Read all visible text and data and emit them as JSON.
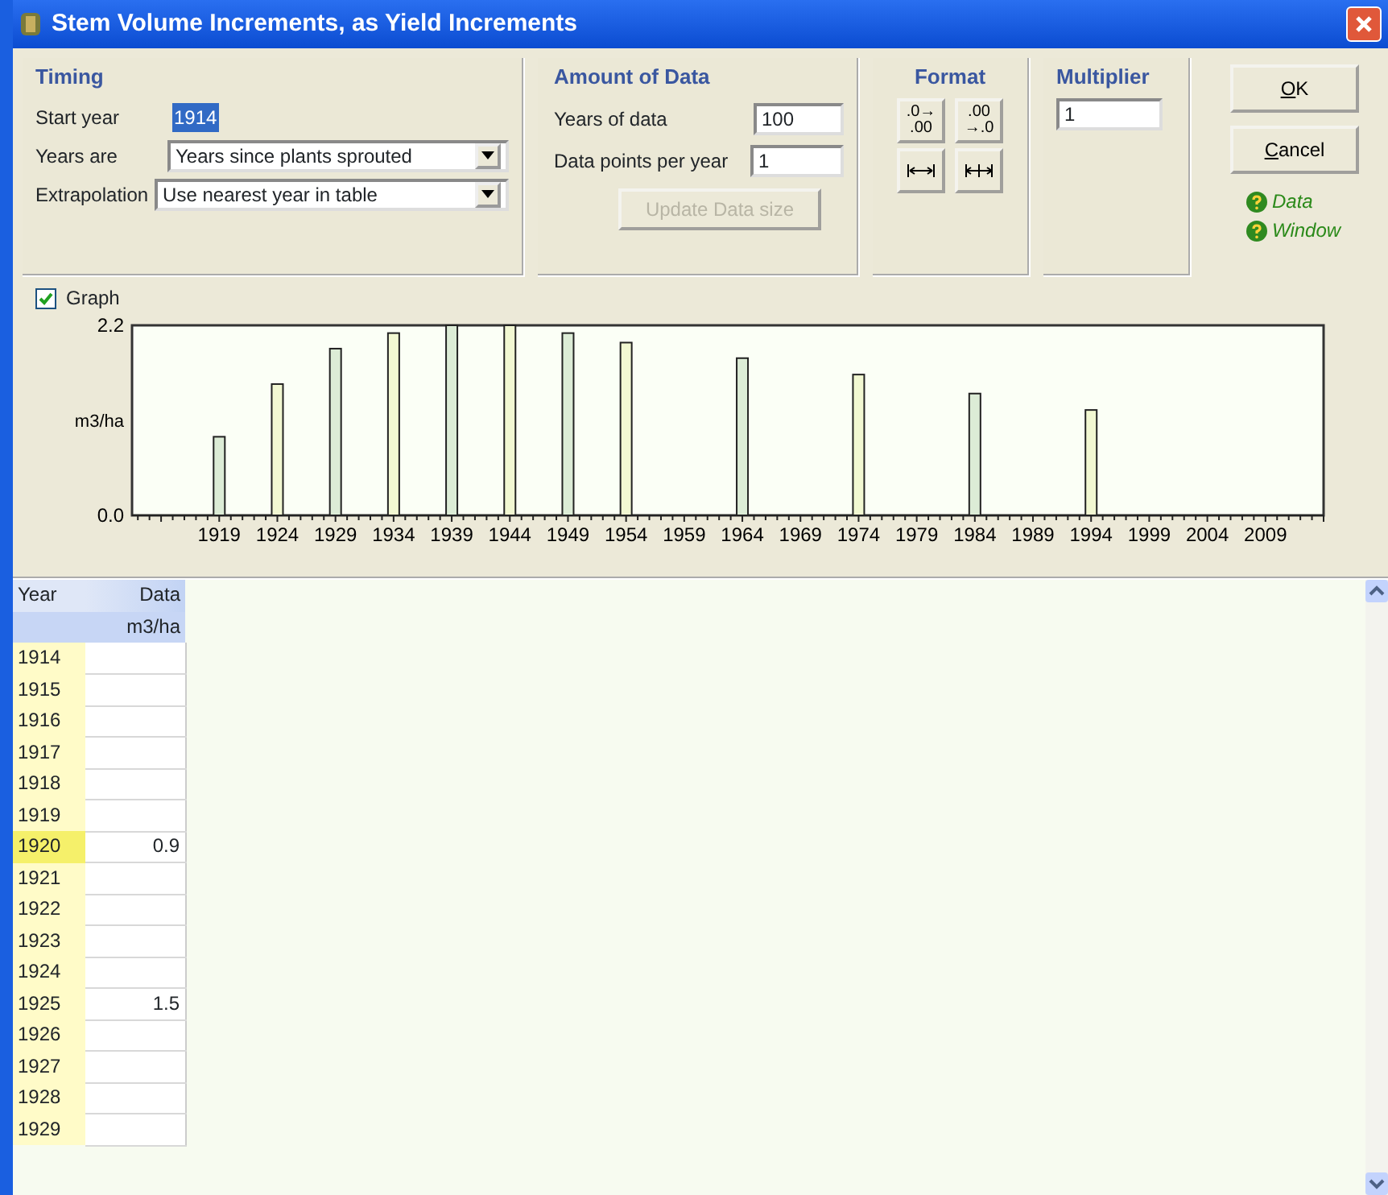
{
  "window": {
    "title": "Stem Volume Increments, as Yield Increments"
  },
  "timing": {
    "title": "Timing",
    "fields": [
      {
        "kind": "text",
        "label": "Start year",
        "value": "1914",
        "selected": true
      },
      {
        "kind": "select",
        "label": "Years are",
        "value": "Years since plants sprouted"
      },
      {
        "kind": "select",
        "label": "Extrapolation",
        "value": "Use nearest year in table"
      }
    ]
  },
  "amount": {
    "title": "Amount of Data",
    "fields": [
      {
        "label": "Years of data",
        "value": "100"
      },
      {
        "label": "Data points per year",
        "value": "1"
      }
    ],
    "update_button": {
      "label": "Update Data size",
      "disabled": true
    }
  },
  "format": {
    "title": "Format",
    "buttons": [
      {
        "kind": "text",
        "lines": [
          ".0→",
          ".00"
        ]
      },
      {
        "kind": "text",
        "lines": [
          ".00",
          "→.0"
        ]
      },
      {
        "kind": "widen"
      },
      {
        "kind": "narrow"
      }
    ]
  },
  "multiplier": {
    "title": "Multiplier",
    "value": "1"
  },
  "buttons": [
    {
      "label": "OK"
    },
    {
      "label": "Cancel"
    }
  ],
  "help_links": [
    "Data",
    "Window"
  ],
  "graph": {
    "label": "Graph",
    "checked": true,
    "chart_data": {
      "type": "bar",
      "ylabel": "m3/ha",
      "x": [
        1919,
        1924,
        1929,
        1934,
        1939,
        1944,
        1949,
        1954,
        1964,
        1974,
        1984,
        1994
      ],
      "series": [
        {
          "values": [
            0.91,
            1.52,
            1.93,
            2.11,
            2.2,
            2.2,
            2.11,
            2.0,
            1.82,
            1.63,
            1.41,
            1.22
          ]
        }
      ],
      "xlim": [
        1911.5,
        2014
      ],
      "ylim": [
        0,
        2.2
      ],
      "xticks": [
        1919,
        1924,
        1929,
        1934,
        1939,
        1944,
        1949,
        1954,
        1959,
        1964,
        1969,
        1974,
        1979,
        1984,
        1989,
        1994,
        1999,
        2004,
        2009
      ],
      "yticks": [
        {
          "value": 0,
          "label": "0.0"
        },
        {
          "value": 2.2,
          "label": "2.2"
        }
      ]
    }
  },
  "table": {
    "columns": [
      {
        "label": "Year"
      },
      {
        "label": "Data",
        "unit": "m3/ha"
      }
    ],
    "rows": [
      {
        "year": "1914",
        "selected": false
      },
      {
        "year": "1915",
        "selected": false
      },
      {
        "year": "1916",
        "selected": false
      },
      {
        "year": "1917",
        "selected": false
      },
      {
        "year": "1918",
        "selected": false
      },
      {
        "year": "1919",
        "selected": false
      },
      {
        "year": "1920",
        "data": "0.9",
        "selected": true
      },
      {
        "year": "1921",
        "selected": false
      },
      {
        "year": "1922",
        "selected": false
      },
      {
        "year": "1923",
        "selected": false
      },
      {
        "year": "1924",
        "selected": false
      },
      {
        "year": "1925",
        "data": "1.5",
        "selected": false
      },
      {
        "year": "1926",
        "selected": false
      },
      {
        "year": "1927",
        "selected": false
      },
      {
        "year": "1928",
        "selected": false
      },
      {
        "year": "1929",
        "selected": false
      }
    ]
  }
}
